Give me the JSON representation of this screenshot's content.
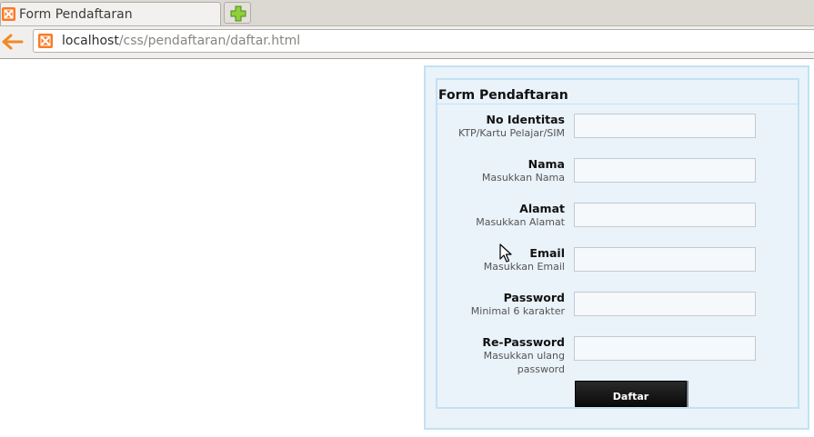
{
  "browser": {
    "tab_title": "Form Pendaftaran",
    "url_host": "localhost",
    "url_path": "/css/pendaftaran/daftar.html"
  },
  "form": {
    "title": "Form Pendaftaran",
    "fields": [
      {
        "label": "No Identitas",
        "hint": "KTP/Kartu Pelajar/SIM",
        "value": ""
      },
      {
        "label": "Nama",
        "hint": "Masukkan Nama",
        "value": ""
      },
      {
        "label": "Alamat",
        "hint": "Masukkan Alamat",
        "value": ""
      },
      {
        "label": "Email",
        "hint": "Masukkan Email",
        "value": ""
      },
      {
        "label": "Password",
        "hint": "Minimal 6 karakter",
        "value": ""
      },
      {
        "label": "Re-Password",
        "hint": "Masukkan ulang password",
        "value": ""
      }
    ],
    "submit_label": "Daftar"
  },
  "colors": {
    "form_background": "#eaf2fa",
    "form_border": "#c3e1f2",
    "button_background": "#111111"
  },
  "icons": {
    "tab": "xampp-favicon-icon",
    "new_tab": "plus-icon",
    "back": "back-arrow-icon",
    "site": "xampp-favicon-icon",
    "cursor": "mouse-pointer-icon"
  }
}
